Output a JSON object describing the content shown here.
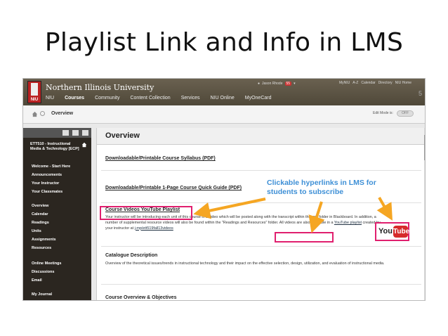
{
  "slide": {
    "title": "Playlist Link and Info in LMS"
  },
  "header": {
    "university": "Northern Illinois University",
    "logo_text": "NIU",
    "nav": [
      "NIU",
      "Courses",
      "Community",
      "Content Collection",
      "Services",
      "NIU Online",
      "MyOneCard"
    ],
    "user_name": "Jason Rhode",
    "user_badge": "55",
    "toplinks": [
      "MyNIU",
      "A-Z",
      "Calendar",
      "Directory",
      "NIU Home"
    ],
    "corner": "5"
  },
  "breadcrumb": {
    "current": "Overview",
    "edit_mode_label": "Edit Mode is:",
    "edit_mode_value": "OFF"
  },
  "sidebar": {
    "course_title": "ETT510 - Instructional Media & Technology [ECP]",
    "items": [
      "Welcome - Start Here",
      "Announcements",
      "Your Instructor",
      "Your Classmates",
      "Overview",
      "Calendar",
      "Readings",
      "Units",
      "Assignments",
      "Resources",
      "Online Meetings",
      "Discussions",
      "Email",
      "My Journal"
    ]
  },
  "content": {
    "title": "Overview",
    "syllabus_link": "Downloadable/Printable Course Syllabus (PDF)",
    "guide_link": "Downloadable/Printable 1-Page Course Quick Guide (PDF)",
    "videos_link": "Course Videos YouTube Playlist",
    "videos_text_1": "Your instructor will be introducing each unit of this course in a video which will be posted along with the transcript within the unit folder in Blackboard. In addition, a number of supplemental resource videos will also be found within the \"Readings and Resources\" folder. All videos are also available in a ",
    "youtube_playlist_link": "YouTube playlist",
    "videos_text_2": " created by your instructor at ",
    "short_url": "j.mp/ett519fall13videos",
    "catalogue_title": "Catalogue Description",
    "catalogue_text": "Overview of the theoretical issues/trends in instructional technology and their impact on the effective selection, design, utilization, and evaluation of instructional media.",
    "objectives_title": "Course Overview & Objectives"
  },
  "annotation": {
    "callout": "Clickable hyperlinks in LMS for students to subscribe",
    "youtube_logo_you": "You",
    "youtube_logo_tube": "Tube"
  },
  "colors": {
    "callout": "#3d8fd6",
    "highlight_box": "#e01f6e",
    "arrow": "#f5a623",
    "header": "#5b5344",
    "sidebar": "#2b2620"
  }
}
